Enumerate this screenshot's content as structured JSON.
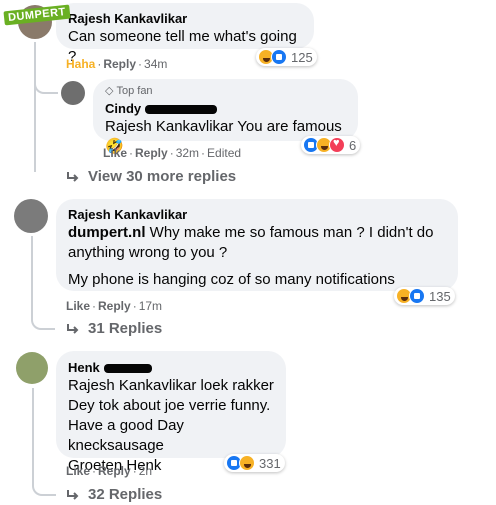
{
  "watermark": "DUMPERT",
  "comments": [
    {
      "author": "Rajesh Kankavlikar",
      "lines": [
        "Can someone tell me what's going ?"
      ],
      "reaction_label": "Haha",
      "reply_label": "Reply",
      "time": "34m",
      "reaction_count": "125",
      "reaction_icons": [
        "haha-icon",
        "like-icon"
      ]
    },
    {
      "badge": "Top fan",
      "author": "Cindy",
      "lines": [
        "Rajesh Kankavlikar You are famous🤣"
      ],
      "like_label": "Like",
      "reply_label": "Reply",
      "time": "32m",
      "edited": "Edited",
      "reaction_count": "6",
      "reaction_icons": [
        "like-icon",
        "haha-icon",
        "love-icon"
      ]
    },
    {
      "view_more": "View 30 more replies"
    },
    {
      "author": "Rajesh Kankavlikar",
      "link": "dumpert.nl",
      "lines": [
        "Why make me so famous man ? I didn't do",
        "anything wrong to you ?",
        "My phone is hanging coz of so many notifications"
      ],
      "like_label": "Like",
      "reply_label": "Reply",
      "time": "17m",
      "reaction_count": "135",
      "replies": "31 Replies"
    },
    {
      "author": "Henk",
      "lines": [
        "Rajesh Kankavlikar loek rakker",
        "Dey tok about joe verrie funny.",
        "Have a good Day knecksausage",
        "Groeten Henk"
      ],
      "like_label": "Like",
      "reply_label": "Reply",
      "time": "2h",
      "reaction_count": "331",
      "replies": "32 Replies"
    }
  ],
  "colors": {
    "bubble": "#f0f2f5",
    "meta": "#65676b",
    "haha_label": "#f7b125",
    "like_blue": "#1877f2"
  }
}
